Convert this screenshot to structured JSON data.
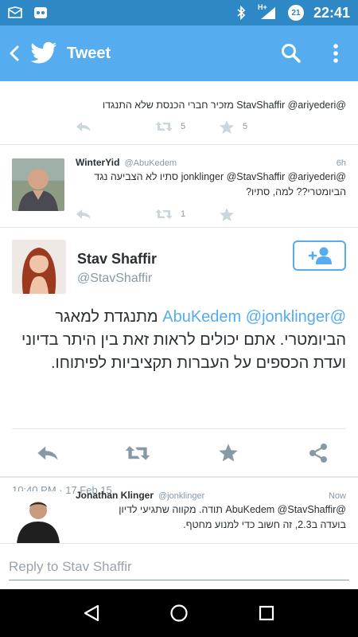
{
  "status_bar": {
    "time": "22:41",
    "network": "H+",
    "battery_level": "21"
  },
  "app_bar": {
    "title": "Tweet"
  },
  "colors": {
    "status_bar": "#2f88c6",
    "app_bar": "#55acee",
    "link": "#55acee",
    "muted": "#8899a6"
  },
  "prior_tweet": {
    "text": "@StavShaffir @ariyederi מזכיר חברי הכנסת שלא התנגדו",
    "retweets": "5",
    "favorites": "5"
  },
  "tweet_winteryid": {
    "name": "WinterYid",
    "handle": "@AbuKedem",
    "time": "6h",
    "text_line1": "@jonklinger @StavShaffir @ariyederi סתיו לא הצביעה נגד",
    "text_line2": "הביומטרי?? למה, סתיו?",
    "retweets": "1"
  },
  "focused_tweet": {
    "name": "Stav Shaffir",
    "handle": "@StavShaffir",
    "mention_1": "@AbuKedem",
    "mention_2": "@jonklinger",
    "text_rest_1": "מתנגדת למאגר",
    "text_rest_2": "הביומטרי. אתם יכולים לראות זאת בין היתר בדיוני ועדת הכספים על העברות תקציביות לפיתוחו.",
    "timestamp": "10:40 PM · 17 Feb 15"
  },
  "tweet_klinger": {
    "name": "Jonathan Klinger",
    "handle": "@jonklinger",
    "time": "Now",
    "text_line1": "@AbuKedem @StavShaffir תודה. מקווה שתגיעי לדיון",
    "text_line2": "בועדה ב2.3, זה חשוב כדי למנוע מחטף."
  },
  "reply": {
    "placeholder": "Reply to Stav Shaffir"
  }
}
